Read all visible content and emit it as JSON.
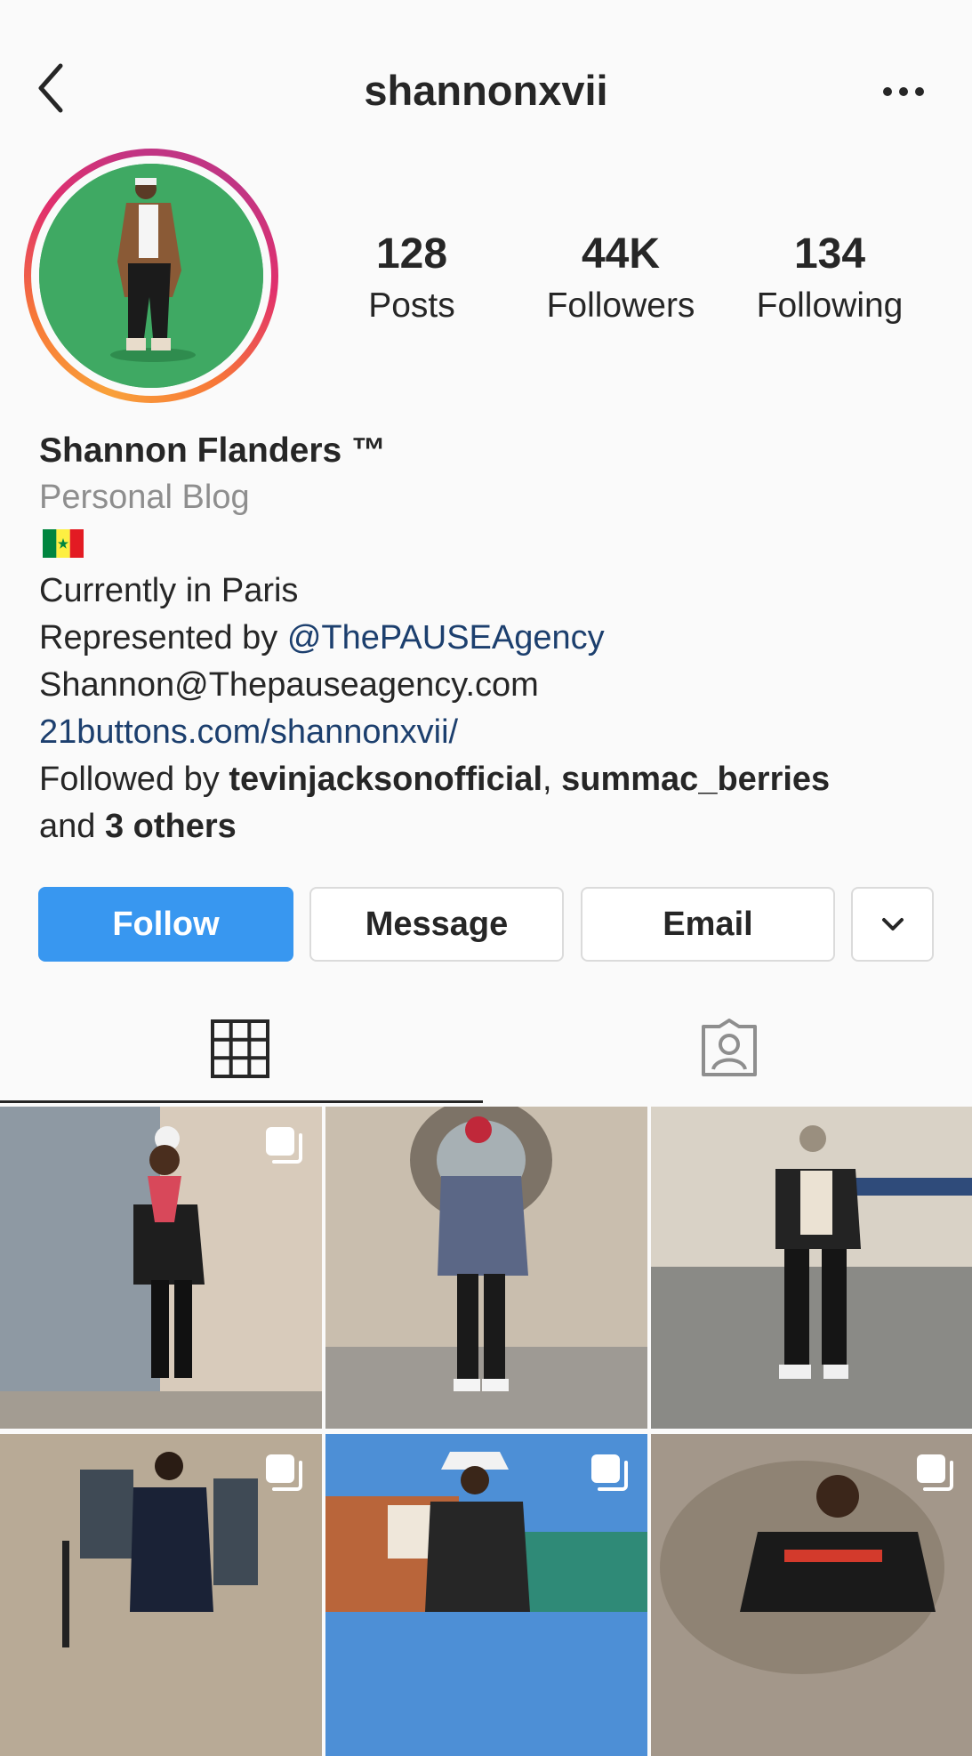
{
  "header": {
    "username": "shannonxvii"
  },
  "stats": [
    {
      "value": "128",
      "label": "Posts"
    },
    {
      "value": "44K",
      "label": "Followers"
    },
    {
      "value": "134",
      "label": "Following"
    }
  ],
  "bio": {
    "name": "Shannon Flanders ™",
    "category": "Personal Blog",
    "flag": "senegal-flag",
    "location": "Currently in Paris",
    "represented_prefix": "Represented by ",
    "represented_handle": "@ThePAUSEAgency",
    "email": "Shannon@Thepauseagency.com",
    "link": "21buttons.com/shannonxvii/",
    "followed_prefix": "Followed by ",
    "followed_user1": "tevinjacksonofficial",
    "followed_sep": ", ",
    "followed_user2": "summac_berries",
    "followed_and": "and ",
    "followed_others": "3 others"
  },
  "buttons": {
    "follow": "Follow",
    "message": "Message",
    "email": "Email"
  },
  "colors": {
    "follow_bg": "#3897f0",
    "link": "#1c3f6e",
    "avatar_bg": "#3fa963"
  },
  "posts": [
    {
      "icon": "multi-photo-icon",
      "multiple": true
    },
    {
      "multiple": false
    },
    {
      "multiple": false
    },
    {
      "icon": "multi-photo-icon",
      "multiple": true
    },
    {
      "icon": "multi-photo-icon",
      "multiple": true
    },
    {
      "icon": "multi-photo-icon",
      "multiple": true
    }
  ]
}
